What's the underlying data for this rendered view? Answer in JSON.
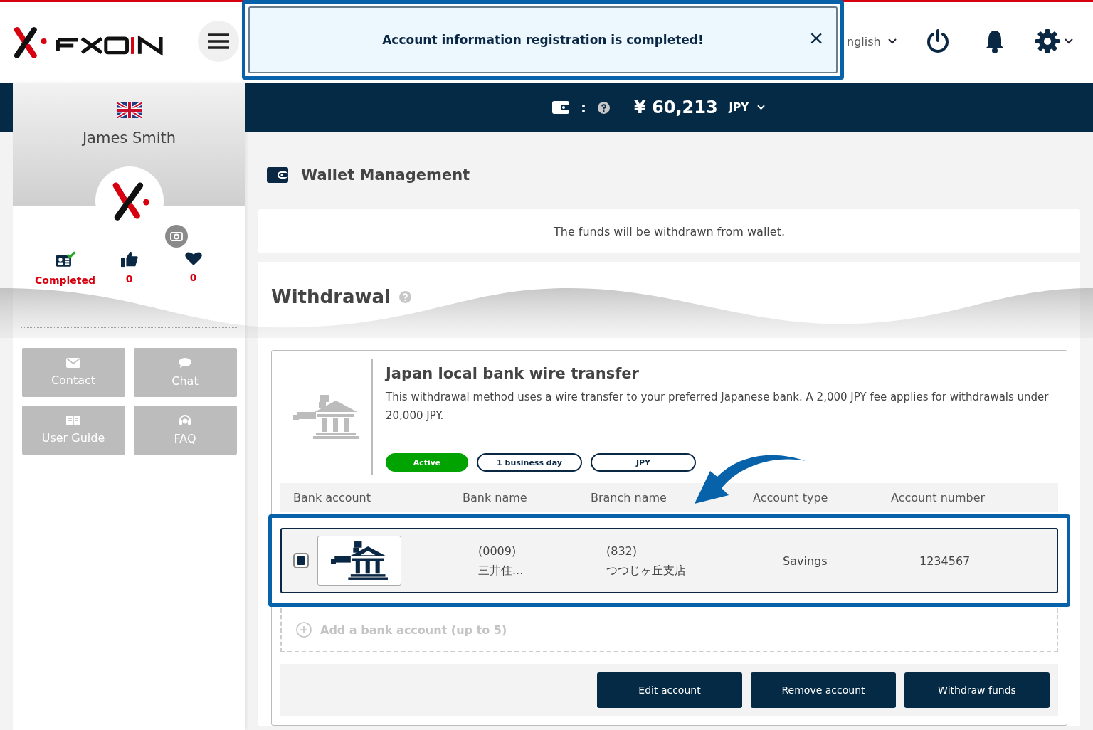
{
  "header": {
    "toast": {
      "message": "Account information registration is completed!",
      "close": "×"
    },
    "language": "nglish"
  },
  "balance": {
    "separator": ":",
    "amount": "¥ 60,213",
    "currency": "JPY"
  },
  "sidebar": {
    "user_name": "James Smith",
    "stats": [
      {
        "kind": "id",
        "value": "Completed"
      },
      {
        "kind": "like",
        "value": "0"
      },
      {
        "kind": "heart",
        "value": "0"
      }
    ],
    "buttons": [
      {
        "kind": "mail",
        "label": "Contact"
      },
      {
        "kind": "chat",
        "label": "Chat"
      },
      {
        "kind": "book",
        "label": "User Guide"
      },
      {
        "kind": "faq",
        "label": "FAQ"
      }
    ]
  },
  "page_title": "Wallet Management",
  "notice": "The funds will be withdrawn from wallet.",
  "section_title": "Withdrawal",
  "method": {
    "title": "Japan local bank wire transfer",
    "description": "This withdrawal method uses a wire transfer to your preferred Japanese bank. A 2,000 JPY fee applies for withdrawals under 20,000 JPY.",
    "tags": [
      {
        "kind": "status",
        "label": "Active"
      },
      {
        "kind": "outline",
        "label": "1 business day"
      },
      {
        "kind": "outline",
        "label": "JPY"
      }
    ]
  },
  "table": {
    "columns": [
      "Bank account",
      "Bank name",
      "Branch name",
      "Account type",
      "Account number"
    ],
    "rows": [
      {
        "selected": true,
        "bank_code": "(0009)",
        "bank_name": "三井住...",
        "branch_code": "(832)",
        "branch_name": "つつじヶ丘支店",
        "account_type": "Savings",
        "account_number": "1234567"
      }
    ]
  },
  "add_account": "Add a bank account (up to 5)",
  "actions": [
    "Edit account",
    "Remove account",
    "Withdraw funds"
  ]
}
